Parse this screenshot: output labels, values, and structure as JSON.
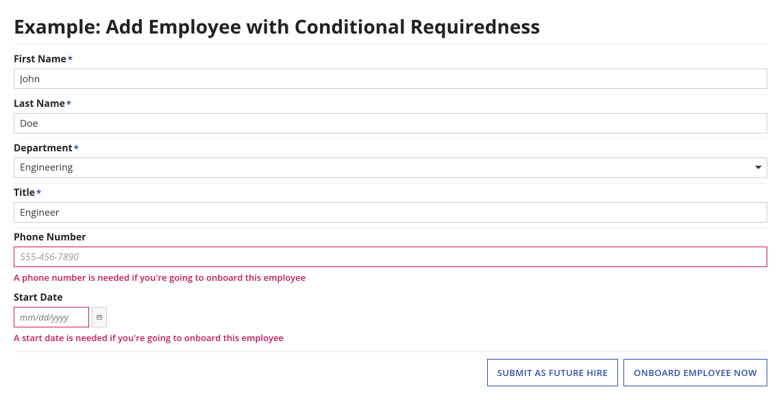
{
  "page_title": "Example: Add Employee with Conditional Requiredness",
  "fields": {
    "first_name": {
      "label": "First Name",
      "value": "John",
      "required": true
    },
    "last_name": {
      "label": "Last Name",
      "value": "Doe",
      "required": true
    },
    "department": {
      "label": "Department",
      "value": "Engineering",
      "required": true
    },
    "title": {
      "label": "Title",
      "value": "Engineer",
      "required": true
    },
    "phone": {
      "label": "Phone Number",
      "value": "",
      "placeholder": "555-456-7890",
      "error": "A phone number is needed if you're going to onboard this employee"
    },
    "start_date": {
      "label": "Start Date",
      "value": "",
      "placeholder": "mm/dd/yyyy",
      "error": "A start date is needed if you're going to onboard this employee"
    }
  },
  "required_marker": "*",
  "buttons": {
    "submit_future": "SUBMIT AS FUTURE HIRE",
    "onboard_now": "ONBOARD EMPLOYEE NOW"
  }
}
